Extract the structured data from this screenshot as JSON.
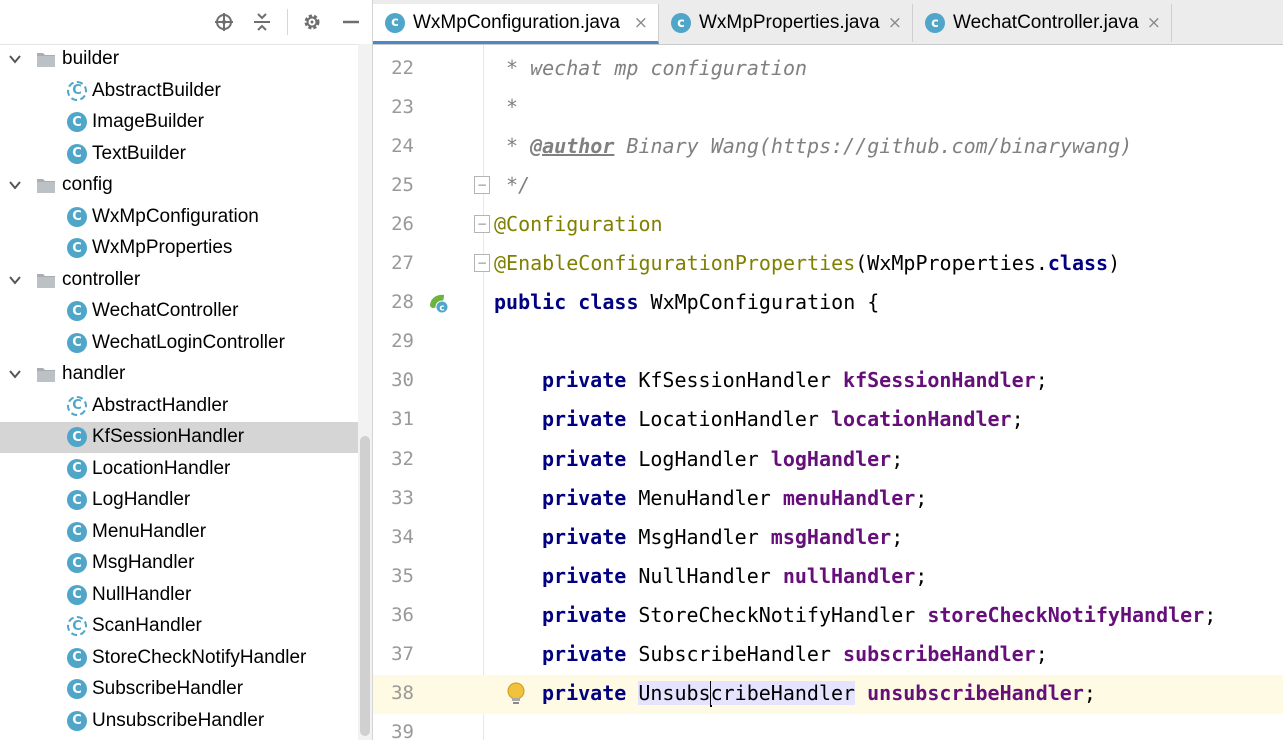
{
  "project_panel": {
    "toolbar": {
      "locate_icon": "crosshair-icon",
      "collapse_icon": "collapse-all-icon",
      "settings_icon": "gear-icon",
      "hide_icon": "minimize-icon"
    },
    "tree": [
      {
        "type": "folder",
        "label": "builder",
        "expanded": true,
        "indent": 0
      },
      {
        "type": "class",
        "label": "AbstractBuilder",
        "abstract": true,
        "indent": 1
      },
      {
        "type": "class",
        "label": "ImageBuilder",
        "abstract": false,
        "indent": 1
      },
      {
        "type": "class",
        "label": "TextBuilder",
        "abstract": false,
        "indent": 1
      },
      {
        "type": "folder",
        "label": "config",
        "expanded": true,
        "indent": 0
      },
      {
        "type": "class",
        "label": "WxMpConfiguration",
        "abstract": false,
        "indent": 1
      },
      {
        "type": "class",
        "label": "WxMpProperties",
        "abstract": false,
        "indent": 1
      },
      {
        "type": "folder",
        "label": "controller",
        "expanded": true,
        "indent": 0
      },
      {
        "type": "class",
        "label": "WechatController",
        "abstract": false,
        "indent": 1
      },
      {
        "type": "class",
        "label": "WechatLoginController",
        "abstract": false,
        "indent": 1
      },
      {
        "type": "folder",
        "label": "handler",
        "expanded": true,
        "indent": 0
      },
      {
        "type": "class",
        "label": "AbstractHandler",
        "abstract": true,
        "indent": 1
      },
      {
        "type": "class",
        "label": "KfSessionHandler",
        "abstract": false,
        "indent": 1,
        "selected": true
      },
      {
        "type": "class",
        "label": "LocationHandler",
        "abstract": false,
        "indent": 1
      },
      {
        "type": "class",
        "label": "LogHandler",
        "abstract": false,
        "indent": 1
      },
      {
        "type": "class",
        "label": "MenuHandler",
        "abstract": false,
        "indent": 1
      },
      {
        "type": "class",
        "label": "MsgHandler",
        "abstract": false,
        "indent": 1
      },
      {
        "type": "class",
        "label": "NullHandler",
        "abstract": false,
        "indent": 1
      },
      {
        "type": "class",
        "label": "ScanHandler",
        "abstract": true,
        "indent": 1
      },
      {
        "type": "class",
        "label": "StoreCheckNotifyHandler",
        "abstract": false,
        "indent": 1
      },
      {
        "type": "class",
        "label": "SubscribeHandler",
        "abstract": false,
        "indent": 1
      },
      {
        "type": "class",
        "label": "UnsubscribeHandler",
        "abstract": false,
        "indent": 1
      }
    ]
  },
  "tabs": [
    {
      "label": "WxMpConfiguration.java",
      "active": true
    },
    {
      "label": "WxMpProperties.java",
      "active": false
    },
    {
      "label": "WechatController.java",
      "active": false
    }
  ],
  "tab_icon_letter": "c",
  "tab_close_glyph": "×",
  "editor": {
    "current_line": 38,
    "lines": [
      {
        "n": "22",
        "tokens": [
          {
            "t": "* ",
            "c": "cmt"
          },
          {
            "t": "wechat mp configuration",
            "c": "cmt"
          }
        ],
        "indent": 1
      },
      {
        "n": "23",
        "tokens": [
          {
            "t": "*",
            "c": "cmt"
          }
        ],
        "indent": 1
      },
      {
        "n": "24",
        "tokens": [
          {
            "t": "* ",
            "c": "cmt"
          },
          {
            "t": "@author",
            "c": "tag"
          },
          {
            "t": " Binary Wang(https://github.com/binarywang)",
            "c": "cmt"
          }
        ],
        "indent": 1
      },
      {
        "n": "25",
        "tokens": [
          {
            "t": "*/",
            "c": "cmt"
          }
        ],
        "indent": 1,
        "fold": true
      },
      {
        "n": "26",
        "tokens": [
          {
            "t": "@Configuration",
            "c": "ann"
          }
        ],
        "indent": 0,
        "fold": true
      },
      {
        "n": "27",
        "tokens": [
          {
            "t": "@EnableConfigurationProperties",
            "c": "ann"
          },
          {
            "t": "(WxMpProperties.",
            "c": ""
          },
          {
            "t": "class",
            "c": "kw"
          },
          {
            "t": ")",
            "c": ""
          }
        ],
        "indent": 0,
        "fold": true
      },
      {
        "n": "28",
        "tokens": [
          {
            "t": "public class ",
            "c": "kw"
          },
          {
            "t": "WxMpConfiguration {",
            "c": ""
          }
        ],
        "indent": 0,
        "gutter_icon": "spring-bean-icon"
      },
      {
        "n": "29",
        "tokens": [],
        "indent": 0
      },
      {
        "n": "30",
        "tokens": [
          {
            "t": "private ",
            "c": "kw"
          },
          {
            "t": "KfSessionHandler ",
            "c": ""
          },
          {
            "t": "kfSessionHandler",
            "c": "fld"
          },
          {
            "t": ";",
            "c": ""
          }
        ],
        "indent": 2
      },
      {
        "n": "31",
        "tokens": [
          {
            "t": "private ",
            "c": "kw"
          },
          {
            "t": "LocationHandler ",
            "c": ""
          },
          {
            "t": "locationHandler",
            "c": "fld"
          },
          {
            "t": ";",
            "c": ""
          }
        ],
        "indent": 2
      },
      {
        "n": "32",
        "tokens": [
          {
            "t": "private ",
            "c": "kw"
          },
          {
            "t": "LogHandler ",
            "c": ""
          },
          {
            "t": "logHandler",
            "c": "fld"
          },
          {
            "t": ";",
            "c": ""
          }
        ],
        "indent": 2
      },
      {
        "n": "33",
        "tokens": [
          {
            "t": "private ",
            "c": "kw"
          },
          {
            "t": "MenuHandler ",
            "c": ""
          },
          {
            "t": "menuHandler",
            "c": "fld"
          },
          {
            "t": ";",
            "c": ""
          }
        ],
        "indent": 2
      },
      {
        "n": "34",
        "tokens": [
          {
            "t": "private ",
            "c": "kw"
          },
          {
            "t": "MsgHandler ",
            "c": ""
          },
          {
            "t": "msgHandler",
            "c": "fld"
          },
          {
            "t": ";",
            "c": ""
          }
        ],
        "indent": 2
      },
      {
        "n": "35",
        "tokens": [
          {
            "t": "private ",
            "c": "kw"
          },
          {
            "t": "NullHandler ",
            "c": ""
          },
          {
            "t": "nullHandler",
            "c": "fld"
          },
          {
            "t": ";",
            "c": ""
          }
        ],
        "indent": 2
      },
      {
        "n": "36",
        "tokens": [
          {
            "t": "private ",
            "c": "kw"
          },
          {
            "t": "StoreCheckNotifyHandler ",
            "c": ""
          },
          {
            "t": "storeCheckNotifyHandler",
            "c": "fld"
          },
          {
            "t": ";",
            "c": ""
          }
        ],
        "indent": 2
      },
      {
        "n": "37",
        "tokens": [
          {
            "t": "private ",
            "c": "kw"
          },
          {
            "t": "SubscribeHandler ",
            "c": ""
          },
          {
            "t": "subscribeHandler",
            "c": "fld"
          },
          {
            "t": ";",
            "c": ""
          }
        ],
        "indent": 2
      },
      {
        "n": "38",
        "tokens": [
          {
            "t": "private ",
            "c": "kw"
          },
          {
            "t": "Unsubs",
            "c": "hl"
          },
          {
            "t": "|",
            "c": "caret"
          },
          {
            "t": "cribeHandler",
            "c": "hl"
          },
          {
            "t": " ",
            "c": ""
          },
          {
            "t": "unsubscribeHandler",
            "c": "fld"
          },
          {
            "t": ";",
            "c": ""
          }
        ],
        "indent": 2,
        "intention_icon": "lightbulb-icon"
      },
      {
        "n": "39",
        "tokens": [],
        "indent": 0
      }
    ]
  },
  "colors": {
    "keyword": "#000080",
    "field": "#660e7a",
    "annotation": "#808000",
    "comment": "#808080",
    "class_icon": "#4fa6c9",
    "current_line": "#fffae3",
    "selection": "#d5d5d5"
  }
}
